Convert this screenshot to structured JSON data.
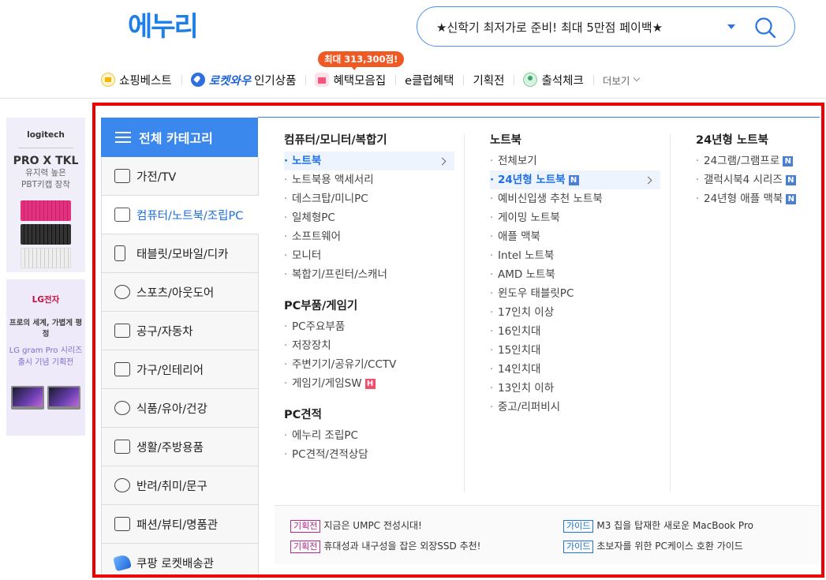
{
  "logo": {
    "text": "에누리"
  },
  "search": {
    "value": "★신학기 최저가로 준비! 최대 5만점 페이백★"
  },
  "topnav": {
    "badge": "최대 313,300점!",
    "items": [
      {
        "label": "쇼핑베스트",
        "icon": "crown-icon"
      },
      {
        "label": "로켓와우",
        "sub": "인기상품",
        "icon": "rocket-icon"
      },
      {
        "label": "혜택모음집",
        "icon": "gift-icon"
      },
      {
        "label": "e클럽혜택"
      },
      {
        "label": "기획전"
      },
      {
        "label": "출석체크",
        "icon": "attendance-icon"
      },
      {
        "label": "더보기"
      }
    ]
  },
  "ads": {
    "ad1": {
      "brand": "logitech",
      "headline": "PRO X TKL",
      "sub1": "유지력 높은",
      "sub2": "PBT키캡 장착"
    },
    "ad2": {
      "brand": "LG전자",
      "t1": "프로의 세계, 가볍게 평정",
      "t2a": "LG gram Pro 시리즈",
      "t2b": "출시 기념 기획전"
    }
  },
  "category": {
    "header": "전체 카테고리",
    "items": [
      {
        "label": "가전/TV"
      },
      {
        "label": "컴퓨터/노트북/조립PC"
      },
      {
        "label": "태블릿/모바일/디카"
      },
      {
        "label": "스포츠/아웃도어"
      },
      {
        "label": "공구/자동차"
      },
      {
        "label": "가구/인테리어"
      },
      {
        "label": "식품/유아/건강"
      },
      {
        "label": "생활/주방용품"
      },
      {
        "label": "반려/취미/문구"
      },
      {
        "label": "패션/뷰티/명품관"
      },
      {
        "label": "쿠팡 로켓배송관"
      }
    ],
    "active_index": 1
  },
  "columns": {
    "col1": {
      "g1": {
        "title": "컴퓨터/모니터/복합기",
        "items": [
          "노트북",
          "노트북용 액세서리",
          "데스크탑/미니PC",
          "일체형PC",
          "소프트웨어",
          "모니터",
          "복합기/프린터/스캐너"
        ]
      },
      "g2": {
        "title": "PC부품/게임기",
        "items": [
          "PC주요부품",
          "저장장치",
          "주변기기/공유기/CCTV",
          "게임기/게임SW"
        ]
      },
      "g3": {
        "title": "PC견적",
        "items": [
          "에누리 조립PC",
          "PC견적/견적상담"
        ]
      }
    },
    "col2": {
      "title": "노트북",
      "items": [
        "전체보기",
        "24년형 노트북",
        "예비신입생 추천 노트북",
        "게이밍 노트북",
        "애플 맥북",
        "Intel 노트북",
        "AMD 노트북",
        "윈도우 태블릿PC",
        "17인치 이상",
        "16인치대",
        "15인치대",
        "14인치대",
        "13인치 이하",
        "중고/리퍼비시"
      ]
    },
    "col3": {
      "title": "24년형 노트북",
      "items": [
        "24그램/그램프로",
        "갤럭시북4 시리즈",
        "24년형 애플 맥북"
      ]
    },
    "tags": {
      "new": "N",
      "hot": "H"
    }
  },
  "promos": [
    {
      "tag": "기획전",
      "text": "지금은 UMPC 전성시대!"
    },
    {
      "tag": "기획전",
      "text": "휴대성과 내구성을 잡은 외장SSD 추천!"
    },
    {
      "tag": "가이드",
      "text": "M3 칩을 탑재한 새로운 MacBook Pro"
    },
    {
      "tag": "가이드",
      "text": "초보자를 위한 PC케이스 호환 가이드"
    }
  ],
  "colors": {
    "accent": "#3a87ee",
    "highlight": "#ee0000",
    "badge": "#ef5a24"
  }
}
